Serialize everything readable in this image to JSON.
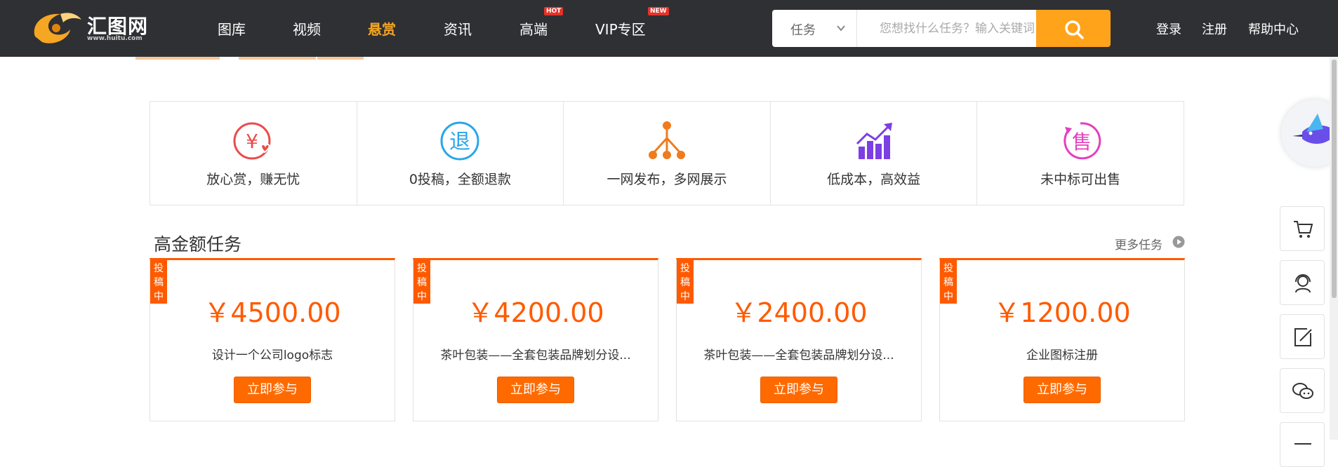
{
  "header": {
    "logo_text": "汇图网",
    "logo_sub": "www.huitu.com",
    "nav": [
      {
        "label": "图库",
        "active": false
      },
      {
        "label": "视频",
        "active": false
      },
      {
        "label": "悬赏",
        "active": true
      },
      {
        "label": "资讯",
        "active": false
      },
      {
        "label": "高端",
        "active": false,
        "badge": "HOT"
      },
      {
        "label": "VIP专区",
        "active": false,
        "badge": "NEW"
      }
    ],
    "search": {
      "category": "任务",
      "placeholder": "您想找什么任务？输入关键词",
      "value": ""
    },
    "links": [
      "登录",
      "注册",
      "帮助中心"
    ]
  },
  "features": [
    {
      "icon": "yen-heart-icon",
      "label": "放心赏，赚无忧",
      "color": "#e94b4b"
    },
    {
      "icon": "refund-icon",
      "label": "0投稿，全额退款",
      "color": "#2ba6e8"
    },
    {
      "icon": "network-tree-icon",
      "label": "一网发布，多网展示",
      "color": "#f07b1d"
    },
    {
      "icon": "growth-chart-icon",
      "label": "低成本，高效益",
      "color": "#7b3fe4"
    },
    {
      "icon": "resale-icon",
      "label": "未中标可出售",
      "color": "#e43fbf"
    }
  ],
  "section": {
    "title": "高金额任务",
    "more_label": "更多任务"
  },
  "tasks": [
    {
      "status": "投稿中",
      "price": "￥4500.00",
      "name": "设计一个公司logo标志",
      "button": "立即参与"
    },
    {
      "status": "投稿中",
      "price": "￥4200.00",
      "name": "茶叶包装——全套包装品牌划分设...",
      "button": "立即参与"
    },
    {
      "status": "投稿中",
      "price": "￥2400.00",
      "name": "茶叶包装——全套包装品牌划分设...",
      "button": "立即参与"
    },
    {
      "status": "投稿中",
      "price": "￥1200.00",
      "name": "企业图标注册",
      "button": "立即参与"
    }
  ],
  "colors": {
    "accent": "#ff5a00",
    "nav_active": "#f5a623",
    "search_button": "#ffa31a",
    "header_bg": "#2f3034"
  },
  "sidebar_icons": [
    "cart-icon",
    "customer-service-icon",
    "edit-icon",
    "wechat-icon",
    "menu-icon"
  ]
}
